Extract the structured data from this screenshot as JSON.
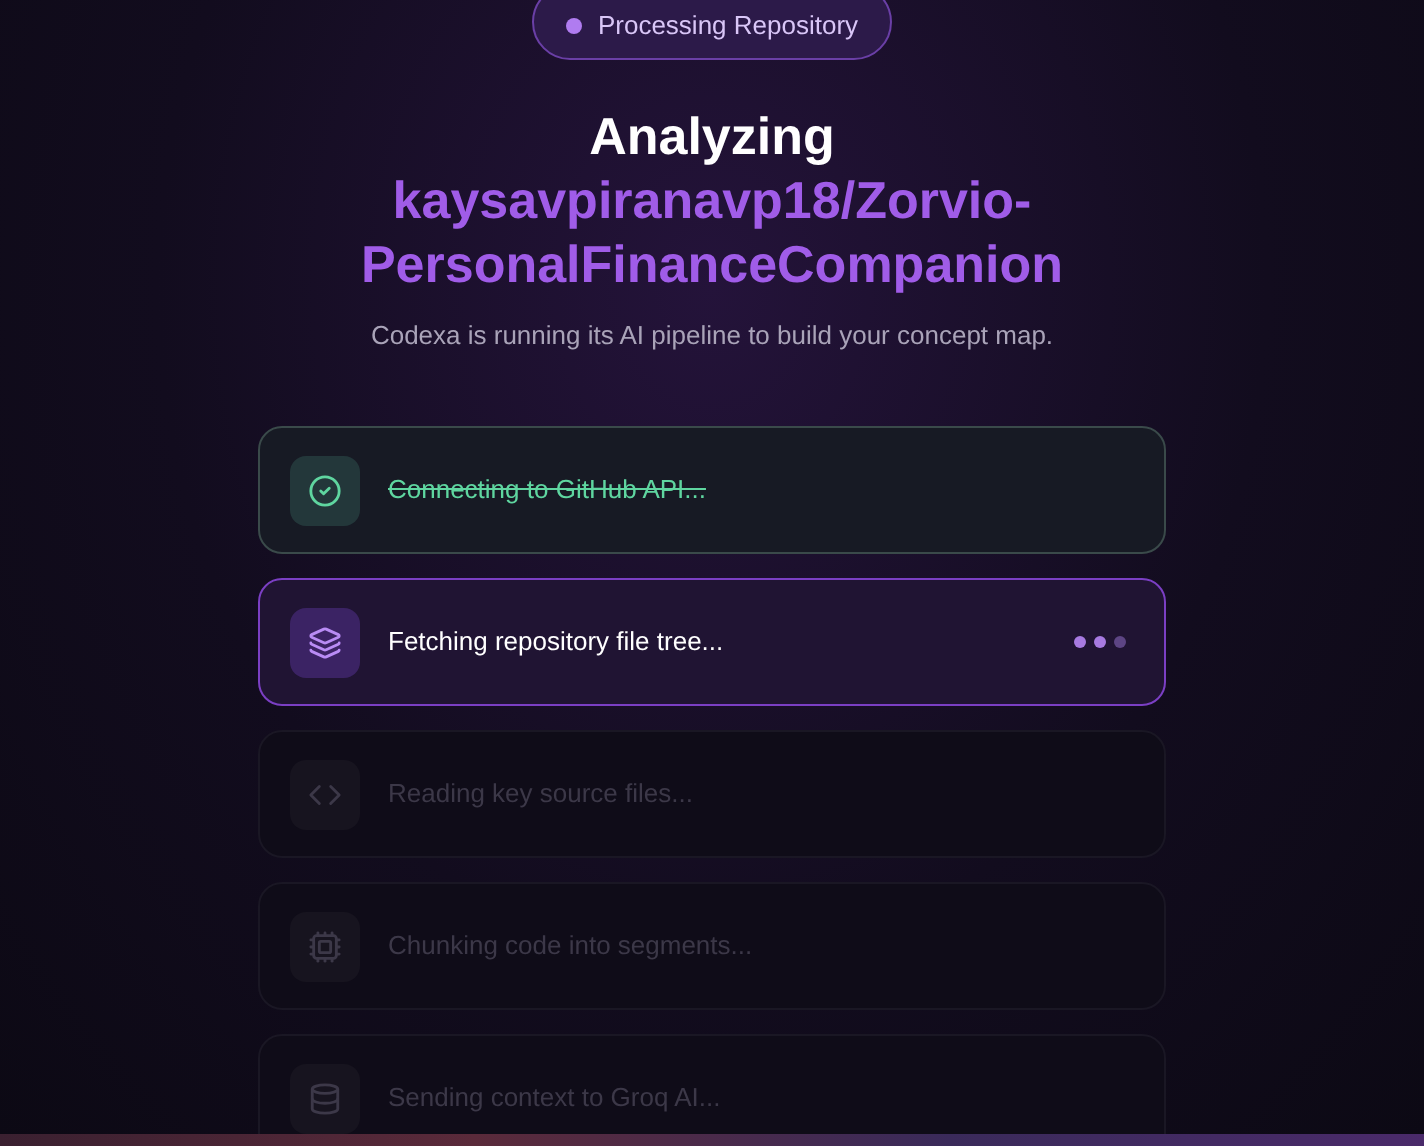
{
  "badge": {
    "label": "Processing Repository"
  },
  "heading": {
    "title": "Analyzing",
    "repository": "kaysavpiranavp18/Zorvio-PersonalFinanceCompanion",
    "subtitle": "Codexa is running its AI pipeline to build your concept map."
  },
  "steps": [
    {
      "label": "Connecting to GitHub API...",
      "done": true,
      "active": false
    },
    {
      "label": "Fetching repository file tree...",
      "done": false,
      "active": true
    },
    {
      "label": "Reading key source files...",
      "done": false,
      "active": false
    },
    {
      "label": "Chunking code into segments...",
      "done": false,
      "active": false
    },
    {
      "label": "Sending context to Groq AI...",
      "done": false,
      "active": false
    }
  ]
}
